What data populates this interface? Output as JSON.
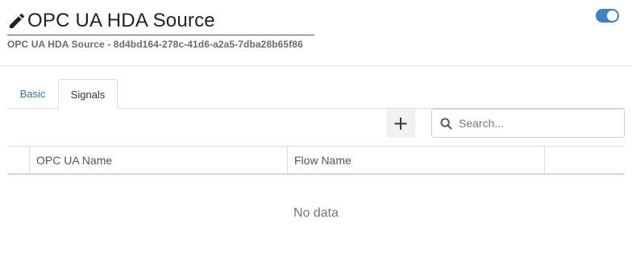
{
  "header": {
    "title": "OPC UA HDA Source",
    "subtitle": "OPC UA HDA Source - 8d4bd164-278c-41d6-a2a5-7dba28b65f86",
    "enabled": true
  },
  "tabs": [
    {
      "label": "Basic",
      "active": false
    },
    {
      "label": "Signals",
      "active": true
    }
  ],
  "toolbar": {
    "add_label": "+",
    "search_placeholder": "Search..."
  },
  "grid": {
    "columns": [
      "",
      "OPC UA Name",
      "Flow Name",
      ""
    ],
    "empty_text": "No data"
  },
  "colors": {
    "accent": "#3d82c4",
    "tab_link": "#2f78b8"
  },
  "icons": {
    "edit": "pencil-icon",
    "search": "search-icon"
  }
}
